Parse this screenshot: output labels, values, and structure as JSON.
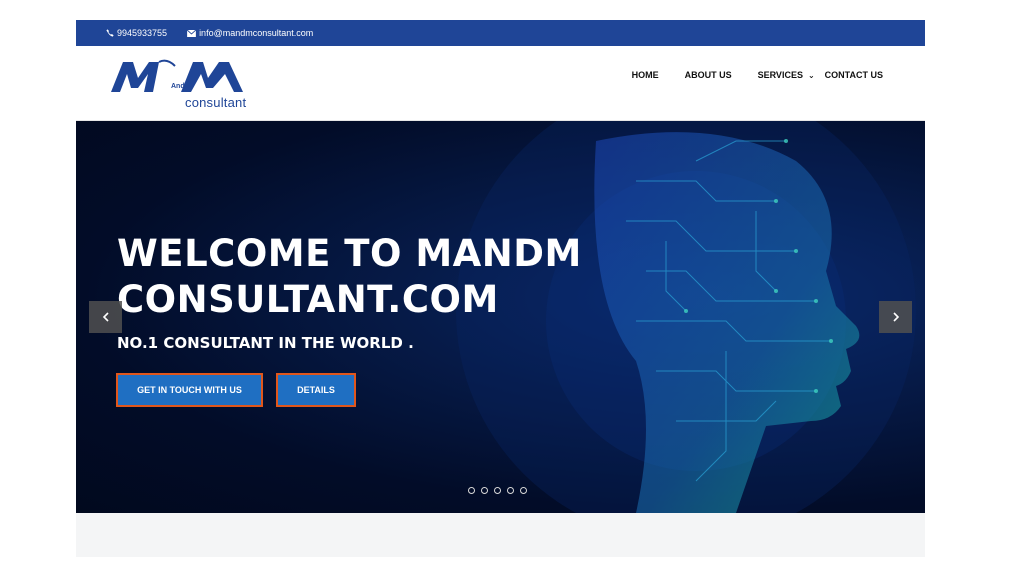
{
  "topbar": {
    "phone": "9945933755",
    "email": "info@mandmconsultant.com",
    "phone_icon": "phone-icon",
    "email_icon": "envelope-icon"
  },
  "logo": {
    "letters": "MM",
    "and": "And",
    "tagline": "consultant"
  },
  "nav": {
    "items": [
      "HOME",
      "ABOUT US",
      "SERVICES",
      "CONTACT US"
    ]
  },
  "hero": {
    "title_line1": "WELCOME TO MANDM",
    "title_line2": "CONSULTANT.COM",
    "subtitle": "NO.1 CONSULTANT IN THE WORLD .",
    "button_contact": "GET IN TOUCH WITH US",
    "button_details": "DETAILS",
    "prev_icon": "chevron-left-icon",
    "next_icon": "chevron-right-icon",
    "slide_count": 5
  },
  "colors": {
    "brand_blue": "#1f4597",
    "button_blue": "#1f6fc2",
    "button_border": "#e0561b",
    "hero_dark": "#020c28"
  }
}
